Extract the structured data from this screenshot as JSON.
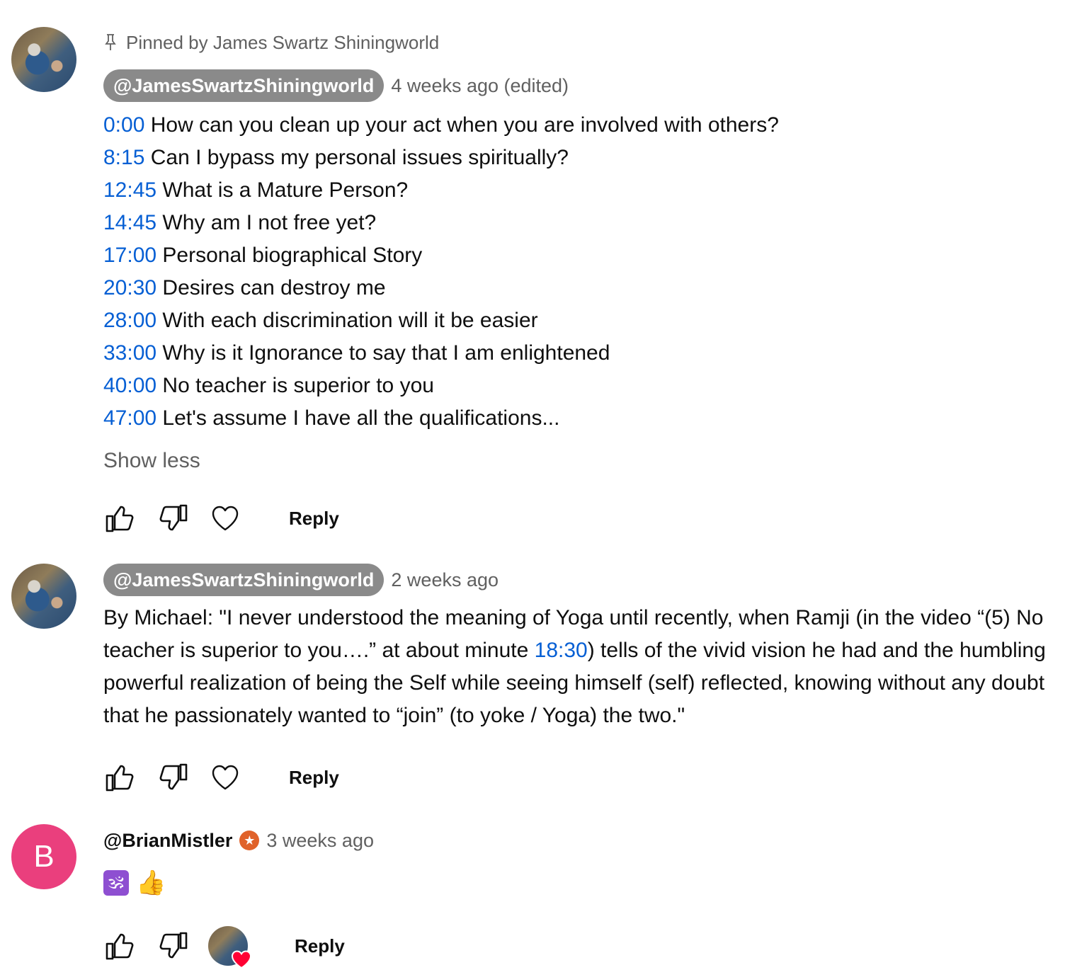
{
  "comments": [
    {
      "pinned_label": "Pinned by James Swartz Shiningworld",
      "author": "@JamesSwartzShiningworld",
      "time": "4 weeks ago (edited)",
      "chapters": [
        {
          "time": "0:00",
          "text": "How can you clean up your act when you are involved with others?"
        },
        {
          "time": "8:15",
          "text": "Can I bypass my personal issues spiritually?"
        },
        {
          "time": "12:45",
          "text": "What is a Mature Person?"
        },
        {
          "time": "14:45",
          "text": "Why am I not free yet?"
        },
        {
          "time": "17:00",
          "text": "Personal biographical Story"
        },
        {
          "time": "20:30",
          "text": "Desires can destroy me"
        },
        {
          "time": "28:00",
          "text": "With each discrimination will it be easier"
        },
        {
          "time": "33:00",
          "text": "Why is it Ignorance to say that I am enlightened"
        },
        {
          "time": "40:00",
          "text": "No teacher is superior to you"
        },
        {
          "time": "47:00",
          "text": "Let's assume I have all the qualifications..."
        }
      ],
      "show_less": "Show less",
      "reply_label": "Reply"
    },
    {
      "author": "@JamesSwartzShiningworld",
      "time": "2 weeks ago",
      "body_before": "By Michael: \"I never understood the meaning of Yoga until recently, when Ramji (in the video “(5) No teacher is superior to you….” at about minute ",
      "body_timestamp": "18:30",
      "body_after": ") tells of the vivid vision he had and the humbling powerful realization of being the Self while seeing himself (self) reflected, knowing without any doubt that he passionately wanted to “join” (to yoke / Yoga) the two.\"",
      "reply_label": "Reply"
    },
    {
      "avatar_letter": "B",
      "author": "@BrianMistler",
      "time": "3 weeks ago",
      "emojis": [
        "🕉",
        "👍"
      ],
      "reply_label": "Reply"
    }
  ],
  "icons": {
    "pin": "pin-icon",
    "like": "thumbs-up-icon",
    "dislike": "thumbs-down-icon",
    "heart": "heart-icon",
    "creator_heart": "creator-heart-icon",
    "star_badge": "star-badge-icon"
  },
  "colors": {
    "timestamp_link": "#065fd4",
    "author_pill_bg": "#8a8a8a",
    "avatar_letter_bg": "#ea3f7d",
    "secondary_text": "#606060",
    "badge": "#e0622a",
    "heart_red": "#ff0033"
  }
}
